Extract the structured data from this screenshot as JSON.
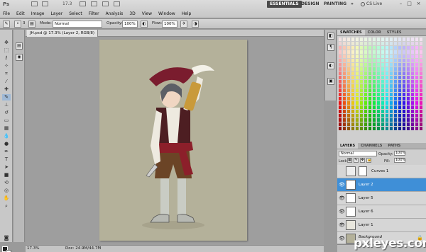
{
  "app": {
    "logo": "Ps",
    "zoom_display": "17.3",
    "workspaces": [
      "ESSENTIALS",
      "DESIGN",
      "PAINTING",
      "»"
    ],
    "cs_live": "CS Live",
    "menu": [
      "File",
      "Edit",
      "Image",
      "Layer",
      "Select",
      "Filter",
      "Analysis",
      "3D",
      "View",
      "Window",
      "Help"
    ]
  },
  "options": {
    "brush_size": "3",
    "mode_label": "Mode:",
    "mode_value": "Normal",
    "opacity_label": "Opacity:",
    "opacity_value": "100%",
    "flow_label": "Flow:",
    "flow_value": "100%"
  },
  "document": {
    "tab_title": "JH.psd @ 17.3% (Layer 2, RGB/8)",
    "status_zoom": "17.3%",
    "status_doc": "Doc: 24.9M/44.7M"
  },
  "panels": {
    "swatch_tabs": [
      "SWATCHES",
      "COLOR",
      "STYLES"
    ],
    "layer_tabs": [
      "LAYERS",
      "CHANNELS",
      "PATHS"
    ],
    "blend_mode": "Normal",
    "opacity_label": "Opacity:",
    "opacity_value": "100%",
    "lock_label": "Lock:",
    "fill_label": "Fill:",
    "fill_value": "100%"
  },
  "layers": [
    {
      "name": "Curves 1",
      "visible": false,
      "selected": false,
      "adjustment": true
    },
    {
      "name": "Layer 2",
      "visible": true,
      "selected": true
    },
    {
      "name": "Layer 5",
      "visible": true,
      "selected": false
    },
    {
      "name": "Layer 6",
      "visible": true,
      "selected": false
    },
    {
      "name": "Layer 1",
      "visible": true,
      "selected": false
    },
    {
      "name": "Background",
      "visible": true,
      "selected": false,
      "locked": true
    }
  ],
  "watermark": "pxleyes.com",
  "colors": {
    "canvas": "#b4b19a",
    "selected_layer": "#3f8fd7",
    "workspace_active": "#4a4a4a"
  }
}
